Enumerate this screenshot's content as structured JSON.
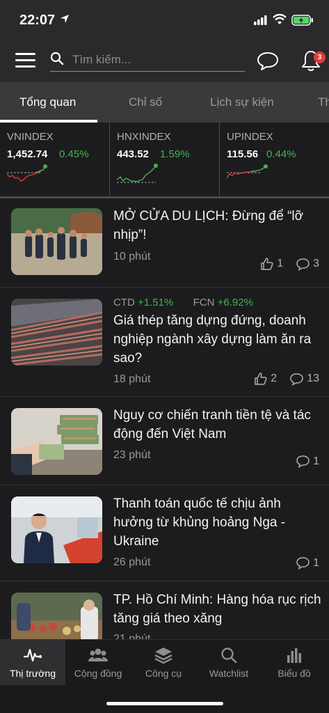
{
  "status_bar": {
    "time": "22:07"
  },
  "header": {
    "search_placeholder": "Tìm kiếm...",
    "notification_count": "3"
  },
  "tabs": [
    {
      "label": "Tổng quan"
    },
    {
      "label": "Chỉ số"
    },
    {
      "label": "Lịch sự kiện"
    },
    {
      "label": "Th"
    }
  ],
  "indices": [
    {
      "name": "VNINDEX",
      "value": "1,452.74",
      "change": "0.45%"
    },
    {
      "name": "HNXINDEX",
      "value": "443.52",
      "change": "1.59%"
    },
    {
      "name": "UPINDEX",
      "value": "115.56",
      "change": "0.44%"
    }
  ],
  "articles": [
    {
      "title": "MỞ CỬA DU LỊCH: Đừng để “lỡ nhịp”!",
      "time": "10 phút",
      "likes": "1",
      "comments": "3"
    },
    {
      "tickers": [
        {
          "code": "CTD",
          "change": "+1.51%"
        },
        {
          "code": "FCN",
          "change": "+6.92%"
        }
      ],
      "title": "Giá thép tăng dựng đứng, doanh nghiệp ngành xây dựng làm ăn ra sao?",
      "time": "18 phút",
      "likes": "2",
      "comments": "13"
    },
    {
      "title": "Nguy cơ chiến tranh tiền tệ và tác động đến Việt Nam",
      "time": "23 phút",
      "comments": "1"
    },
    {
      "title": "Thanh toán quốc tế chịu ảnh hưởng từ khủng hoảng Nga - Ukraine",
      "time": "26 phút",
      "comments": "1"
    },
    {
      "title": "TP. Hồ Chí Minh: Hàng hóa rục rịch tăng giá theo xăng",
      "time": "21 phút"
    }
  ],
  "bottom_nav": [
    {
      "label": "Thị trường",
      "icon": "pulse-icon"
    },
    {
      "label": "Cộng đồng",
      "icon": "community-icon"
    },
    {
      "label": "Công cụ",
      "icon": "layers-icon"
    },
    {
      "label": "Watchlist",
      "icon": "search-icon"
    },
    {
      "label": "Biểu đồ",
      "icon": "bar-chart-icon"
    }
  ]
}
